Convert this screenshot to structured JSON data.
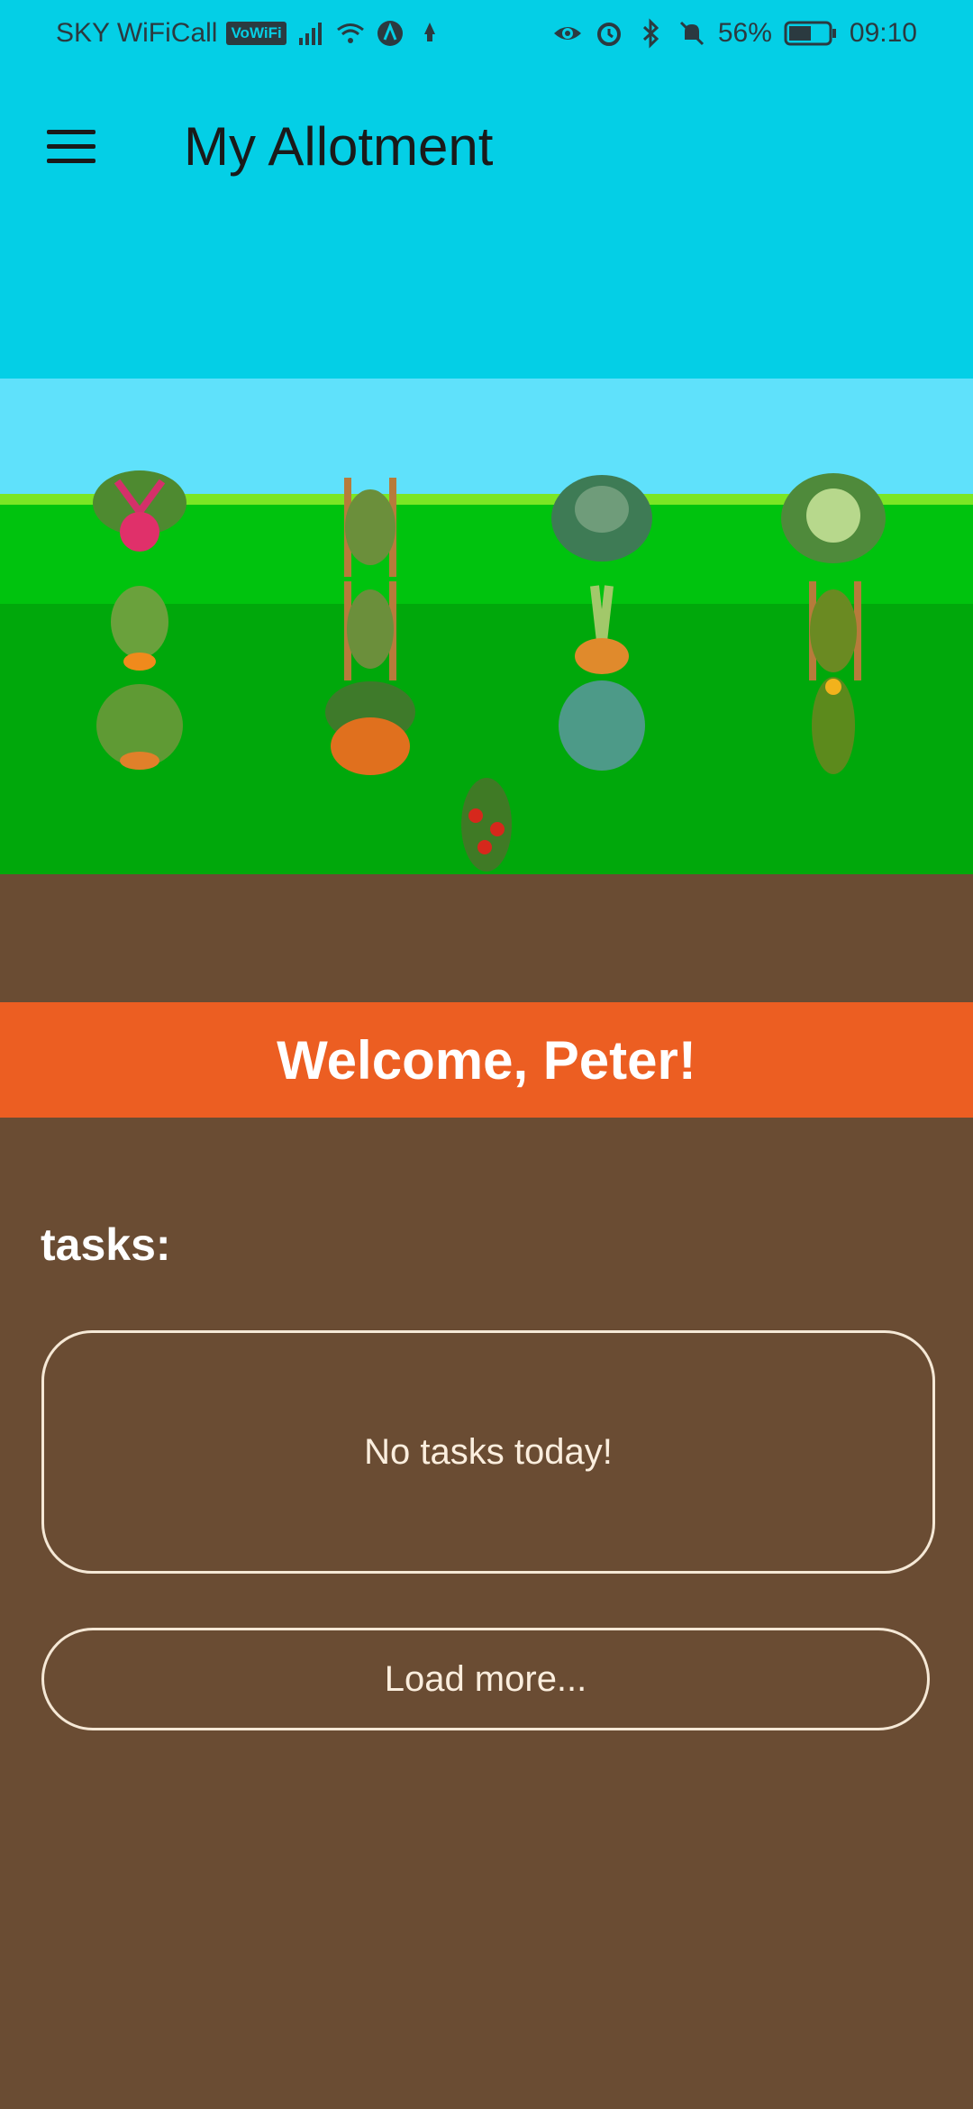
{
  "status_bar": {
    "carrier": "SKY WiFiCall",
    "vowifi_badge": "VoWiFi",
    "battery": "56%",
    "time": "09:10",
    "icons": [
      "signal-icon",
      "wifi-icon",
      "vpn-icon",
      "notification-icon",
      "eye-icon",
      "alarm-icon",
      "bluetooth-icon",
      "mute-icon",
      "battery-icon"
    ]
  },
  "app_bar": {
    "title": "My Allotment",
    "menu_icon": "hamburger-menu-icon"
  },
  "scene": {
    "plants": [
      "beetroot",
      "runner-beans",
      "kale",
      "cabbage",
      "carrot",
      "runner-beans",
      "onion",
      "climbing-beans",
      "courgette",
      "pumpkin",
      "cabbage",
      "sweetcorn",
      "tomato"
    ],
    "colors": {
      "sky": "#04cfe6",
      "sky_light": "#5fe1fb",
      "grass_top": "#00c30e",
      "grass": "#00a80b",
      "soil": "#6a4c33"
    }
  },
  "welcome": {
    "text": "Welcome, Peter!",
    "color": "#ec5e22"
  },
  "tasks": {
    "label": "tasks:",
    "empty_message": "No tasks today!",
    "load_more": "Load more..."
  }
}
